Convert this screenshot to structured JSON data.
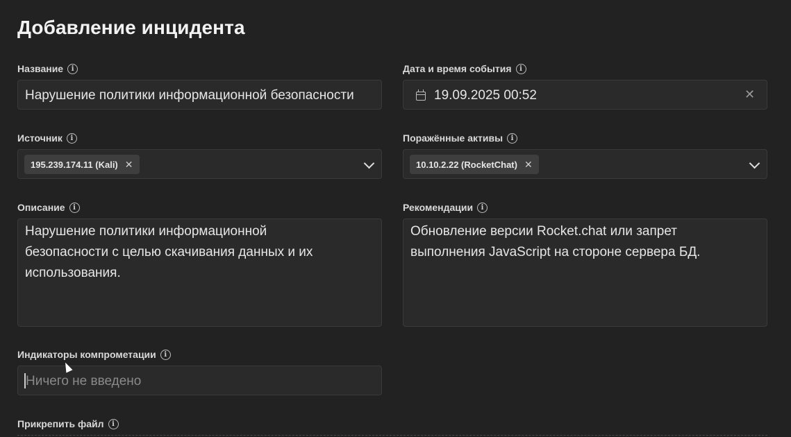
{
  "page": {
    "title": "Добавление инцидента"
  },
  "fields": {
    "name": {
      "label": "Название",
      "value": "Нарушение политики информационной безопасности"
    },
    "datetime": {
      "label": "Дата и время события",
      "value": "19.09.2025 00:52"
    },
    "source": {
      "label": "Источник",
      "tag": "195.239.174.11 (Kali)"
    },
    "assets": {
      "label": "Поражённые активы",
      "tag": "10.10.2.22 (RocketChat)"
    },
    "description": {
      "label": "Описание",
      "lines": [
        "Нарушение политики информационной",
        "безопасности с целью скачивания данных и их",
        "использования."
      ]
    },
    "recommendations": {
      "label": "Рекомендации",
      "lines": [
        "Обновление версии Rocket.chat или запрет",
        "выполнения JavaScript на стороне сервера БД."
      ]
    },
    "ioc": {
      "label": "Индикаторы компрометации",
      "placeholder": "Ничего не введено"
    },
    "attach": {
      "label": "Прикрепить файл"
    }
  },
  "icons": {
    "info": "info-icon",
    "tag_remove": "close-icon",
    "dropdown": "chevron-down-icon",
    "clear": "clear-icon",
    "calendar": "calendar-icon"
  },
  "colors": {
    "background": "#222222",
    "field": "#2a2a2a",
    "tag": "#3e3e3e",
    "text": "#e6e6e6"
  }
}
